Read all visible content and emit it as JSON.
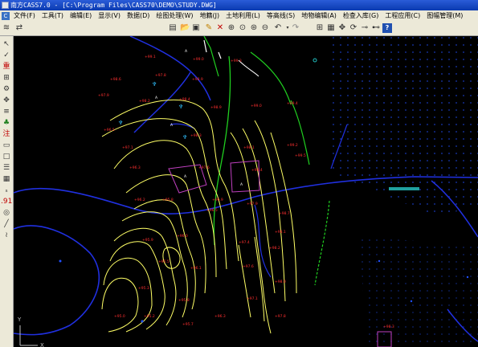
{
  "window": {
    "title": "南方CASS7.0 - [C:\\Program Files\\CASS70\\DEMO\\STUDY.DWG]"
  },
  "menu": {
    "items": [
      "文件(F)",
      "工具(T)",
      "编辑(E)",
      "显示(V)",
      "数据(D)",
      "绘图处理(W)",
      "地籍(J)",
      "土地利用(L)",
      "等高线(S)",
      "地物编辑(A)",
      "检查入库(G)",
      "工程应用(C)",
      "图幅管理(M)"
    ]
  },
  "toolbar": {
    "layer_value": "0"
  },
  "left_toolbar": {
    "icons": [
      {
        "name": "pointer-icon",
        "glyph": "↖"
      },
      {
        "name": "check-icon",
        "glyph": "✓"
      },
      {
        "name": "heavy-icon",
        "glyph": "重",
        "color": "#c00000"
      },
      {
        "name": "chart-icon",
        "glyph": "⊞"
      },
      {
        "name": "gear-icon",
        "glyph": "⚙"
      },
      {
        "name": "compass-icon",
        "glyph": "✥"
      },
      {
        "name": "stairs-icon",
        "glyph": "≡"
      },
      {
        "name": "tree-icon",
        "glyph": "♣",
        "color": "#208020"
      },
      {
        "name": "note-icon",
        "glyph": "注",
        "color": "#c00000"
      },
      {
        "name": "box-icon",
        "glyph": "▭"
      },
      {
        "name": "rect-icon",
        "glyph": "□"
      },
      {
        "name": "list-icon",
        "glyph": "☰"
      },
      {
        "name": "road-icon",
        "glyph": "▦"
      },
      {
        "name": "elevation-icon",
        "glyph": "ₛ"
      },
      {
        "name": "point-icon",
        "glyph": ".91",
        "color": "#c00000"
      },
      {
        "name": "circle-icon",
        "glyph": "◎"
      },
      {
        "name": "line-icon",
        "glyph": "╱"
      },
      {
        "name": "wave-icon",
        "glyph": "≀"
      }
    ]
  },
  "canvas": {
    "background": "#000000",
    "colors": {
      "contour": "#ffff66",
      "label": "#ff3030",
      "road": "#3040ff",
      "green_line": "#20d020",
      "building": "#c040c0",
      "dots": "#1030a0",
      "white_line": "#ffffff"
    },
    "axis": {
      "y_label": "Y",
      "x_label": "X"
    }
  }
}
